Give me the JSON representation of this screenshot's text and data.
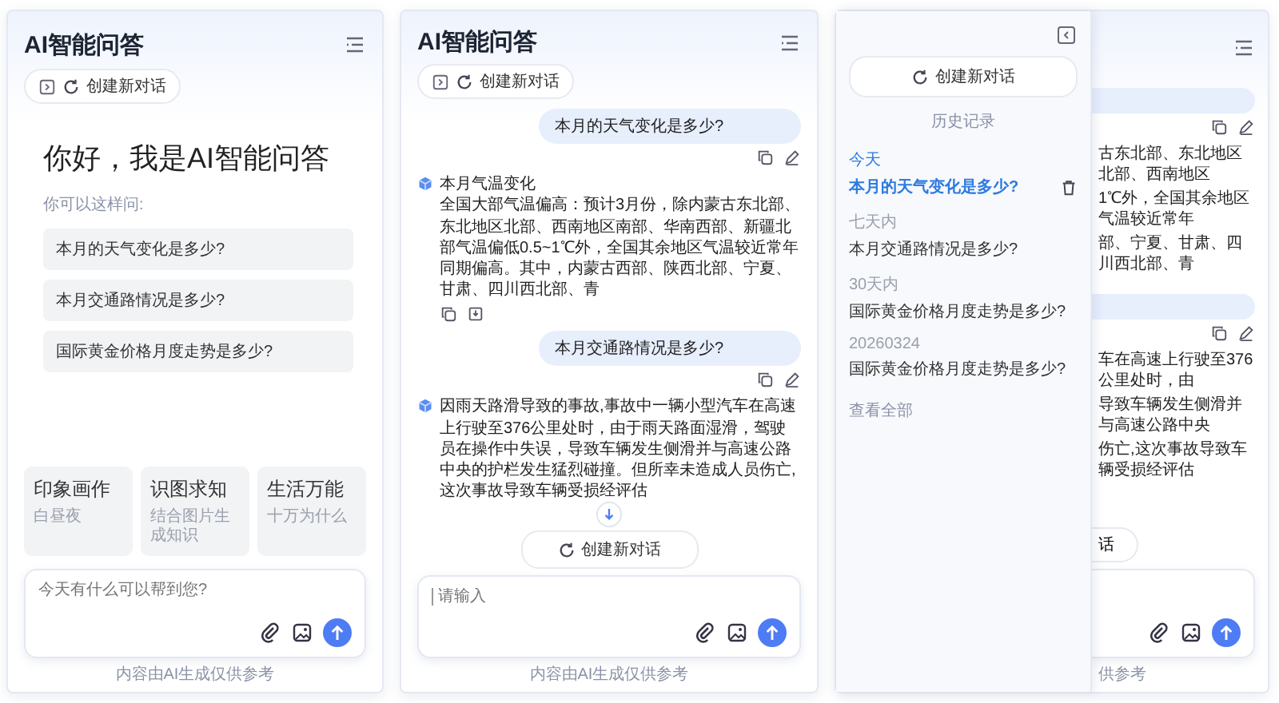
{
  "screens": [
    {
      "kind": "welcome",
      "title": "AI智能问答",
      "new_chat": "创建新对话",
      "greeting": "你好，我是AI智能问答",
      "hint": "你可以这样问:",
      "suggestions": [
        "本月的天气变化是多少?",
        "本月交通路情况是多少?",
        "国际黄金价格月度走势是多少?"
      ],
      "features": [
        {
          "title": "印象画作",
          "subtitle": "白昼夜"
        },
        {
          "title": "识图求知",
          "subtitle": "结合图片生成知识"
        },
        {
          "title": "生活万能",
          "subtitle": "十万为什么"
        }
      ],
      "input": {
        "placeholder": "今天有什么可以帮到您?"
      },
      "footer": "内容由AI生成仅供参考"
    },
    {
      "kind": "chat",
      "title": "AI智能问答",
      "new_chat": "创建新对话",
      "messages": [
        {
          "kind": "question",
          "text": "本月的天气变化是多少?",
          "actions": true
        },
        {
          "kind": "answer",
          "title": "本月气温变化",
          "text": "全国大部气温偏高：预计3月份，除内蒙古东北部、东北地区北部、西南地区南部、华南西部、新疆北部气温偏低0.5~1℃外，全国其余地区气温较近常年同期偏高。其中，内蒙古西部、陕西北部、宁夏、甘肃、四川西北部、青",
          "actions": true
        },
        {
          "kind": "question",
          "text": "本月交通路情况是多少?",
          "actions": true
        },
        {
          "kind": "answer",
          "text": "因雨天路滑导致的事故,事故中一辆小型汽车在高速上行驶至376公里处时，由于雨天路面湿滑，驾驶员在操作中失误，导致车辆发生侧滑并与高速公路中央的护栏发生猛烈碰撞。但所幸未造成人员伤亡,这次事故导致车辆受损经评估",
          "actions": false
        }
      ],
      "new_chat_button": "创建新对话",
      "input": {
        "placeholder": "请输入"
      },
      "footer": "内容由AI生成仅供参考"
    },
    {
      "kind": "history",
      "new_chat": "创建新对话",
      "history_label": "历史记录",
      "groups": [
        {
          "label": "今天",
          "items": [
            {
              "text": "本月的天气变化是多少?",
              "selected": true
            }
          ]
        },
        {
          "label": "七天内",
          "items": [
            {
              "text": "本月交通路情况是多少?",
              "selected": false
            }
          ]
        },
        {
          "label": "30天内",
          "items": [
            {
              "text": "国际黄金价格月度走势是多少?",
              "selected": false
            }
          ]
        },
        {
          "label": "20260324",
          "items": [
            {
              "text": "国际黄金价格月度走势是多少?",
              "selected": false
            }
          ]
        }
      ],
      "view_all": "查看全部",
      "behind": {
        "fragments_1": [
          "古东北部、东北地区北部、西南地区",
          "1℃外，全国其余地区气温较近常年",
          "部、宁夏、甘肃、四川西北部、青"
        ],
        "fragments_2": [
          "车在高速上行驶至376公里处时，由",
          "导致车辆发生侧滑并与高速公路中央",
          "伤亡,这次事故导致车辆受损经评估"
        ],
        "button_fragment": "话",
        "footer_fragment": "供参考"
      }
    }
  ]
}
